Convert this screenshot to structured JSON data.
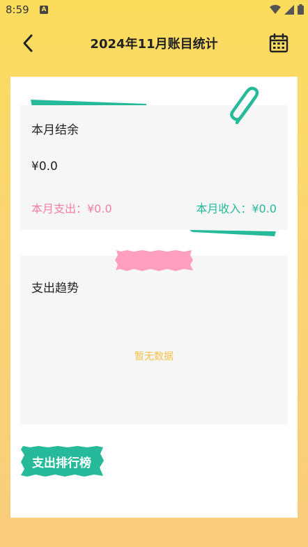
{
  "status_bar": {
    "time": "8:59",
    "notification_badge": "A",
    "icons": [
      "wifi-icon",
      "signal-icon",
      "battery-icon"
    ]
  },
  "app_bar": {
    "title": "2024年11月账目统计",
    "back_icon": "chevron-left-icon",
    "calendar_icon": "calendar-icon"
  },
  "balance": {
    "label": "本月结余",
    "value": "¥0.0",
    "expense_text": "本月支出：¥0.0",
    "income_text": "本月收入：¥0.0"
  },
  "trend": {
    "title": "支出趋势",
    "empty_text": "暂无数据"
  },
  "ranking": {
    "label": "支出排行榜"
  },
  "colors": {
    "background_top": "#fbdc5c",
    "background_bottom": "#f9cc7c",
    "expense": "#f47fa4",
    "income": "#26b99a",
    "empty_text": "#f5c048",
    "teal": "#26b99a",
    "pink_tape": "#ff9fbf"
  }
}
